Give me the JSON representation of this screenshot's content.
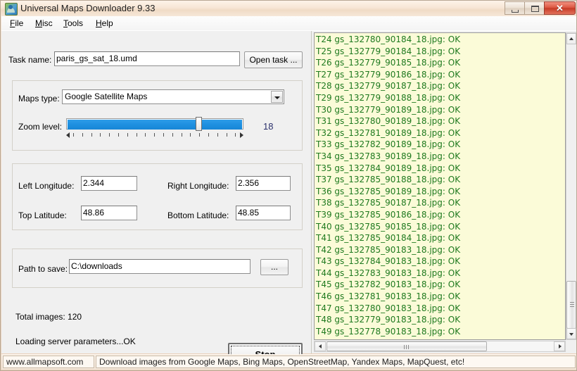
{
  "window": {
    "title": "Universal Maps Downloader 9.33",
    "icon": "globe-map-icon",
    "controls": {
      "minimize": "minimize-icon",
      "maximize": "maximize-icon",
      "close": "✕"
    }
  },
  "menu": {
    "items": [
      {
        "label": "File",
        "accel": "F"
      },
      {
        "label": "Misc",
        "accel": "M"
      },
      {
        "label": "Tools",
        "accel": "T"
      },
      {
        "label": "Help",
        "accel": "H"
      }
    ]
  },
  "form": {
    "task_name_label": "Task name:",
    "task_name_value": "paris_gs_sat_18.umd",
    "open_task_button": "Open task ...",
    "maps_type_label": "Maps type:",
    "maps_type_value": "Google Satellite Maps",
    "zoom_level_label": "Zoom level:",
    "zoom_level_value": "18",
    "left_longitude_label": "Left Longitude:",
    "left_longitude_value": "2.344",
    "right_longitude_label": "Right Longitude:",
    "right_longitude_value": "2.356",
    "top_latitude_label": "Top Latitude:",
    "top_latitude_value": "48.86",
    "bottom_latitude_label": "Bottom Latitude:",
    "bottom_latitude_value": "48.85",
    "path_to_save_label": "Path to save:",
    "path_to_save_value": "C:\\downloads",
    "browse_button": "...",
    "total_images_label": "Total images:  120",
    "status_message": "Loading server parameters...OK",
    "stop_button": "Stop"
  },
  "log": {
    "lines": [
      "T24 gs_132780_90184_18.jpg: OK",
      "T25 gs_132779_90184_18.jpg: OK",
      "T26 gs_132779_90185_18.jpg: OK",
      "T27 gs_132779_90186_18.jpg: OK",
      "T28 gs_132779_90187_18.jpg: OK",
      "T29 gs_132779_90188_18.jpg: OK",
      "T30 gs_132779_90189_18.jpg: OK",
      "T31 gs_132780_90189_18.jpg: OK",
      "T32 gs_132781_90189_18.jpg: OK",
      "T33 gs_132782_90189_18.jpg: OK",
      "T34 gs_132783_90189_18.jpg: OK",
      "T35 gs_132784_90189_18.jpg: OK",
      "T37 gs_132785_90188_18.jpg: OK",
      "T36 gs_132785_90189_18.jpg: OK",
      "T38 gs_132785_90187_18.jpg: OK",
      "T39 gs_132785_90186_18.jpg: OK",
      "T40 gs_132785_90185_18.jpg: OK",
      "T41 gs_132785_90184_18.jpg: OK",
      "T42 gs_132785_90183_18.jpg: OK",
      "T43 gs_132784_90183_18.jpg: OK",
      "T44 gs_132783_90183_18.jpg: OK",
      "T45 gs_132782_90183_18.jpg: OK",
      "T46 gs_132781_90183_18.jpg: OK",
      "T47 gs_132780_90183_18.jpg: OK",
      "T48 gs_132779_90183_18.jpg: OK",
      "T49 gs_132778_90183_18.jpg: OK"
    ]
  },
  "statusbar": {
    "left": "www.allmapsoft.com",
    "right": "Download images from Google Maps, Bing Maps, OpenStreetMap, Yandex Maps, MapQuest, etc!"
  },
  "colors": {
    "log_text": "#1f7a1f",
    "log_background": "#fbfbd8",
    "slider_fill": "#1e90e0",
    "zoom_value_text": "#2a2f6b",
    "titlebar": "#f3e1d0"
  }
}
